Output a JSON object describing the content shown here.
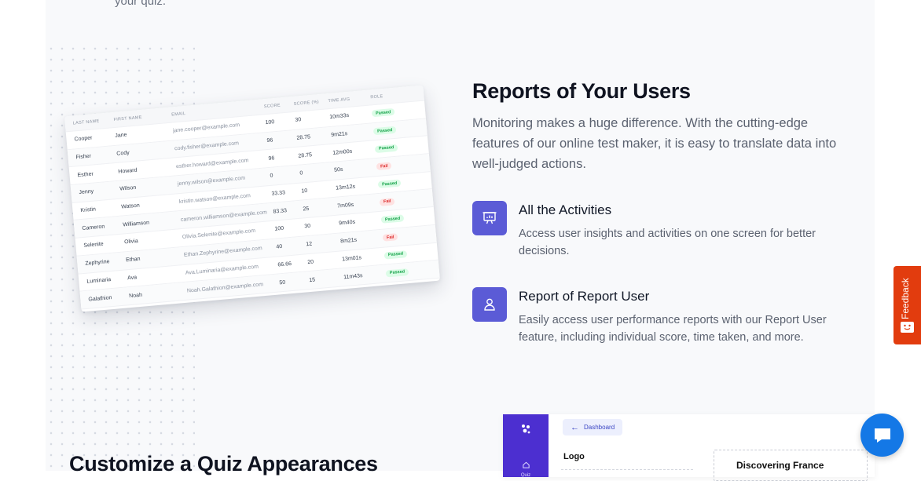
{
  "top_snippet": "your quiz.",
  "section": {
    "title": "Reports of Your Users",
    "lead": "Monitoring makes a huge difference. With the cutting-edge features of our online test maker, it is easy to translate data into well-judged actions.",
    "features": [
      {
        "title": "All the Activities",
        "desc": "Access user insights and activities on one screen for better decisions.",
        "icon": "presentation-chart-icon"
      },
      {
        "title": "Report of Report User",
        "desc": "Easily access user performance reports with our Report User feature, including individual score, time taken, and more.",
        "icon": "user-icon"
      }
    ]
  },
  "report_table": {
    "headers": [
      "Last Name",
      "First Name",
      "Email",
      "Score",
      "Score (%)",
      "Time Avg",
      "Role"
    ],
    "rows": [
      [
        "Cooper",
        "Jane",
        "jane.cooper@example.com",
        "100",
        "30",
        "10m33s",
        "Passed"
      ],
      [
        "Fisher",
        "Cody",
        "cody.fisher@example.com",
        "96",
        "28.75",
        "9m21s",
        "Passed"
      ],
      [
        "Esther",
        "Howard",
        "esther.howard@example.com",
        "96",
        "28.75",
        "12m00s",
        "Passed"
      ],
      [
        "Jenny",
        "Wilson",
        "jenny.wilson@example.com",
        "0",
        "0",
        "50s",
        "Fail"
      ],
      [
        "Kristin",
        "Watson",
        "kristin.watson@example.com",
        "33.33",
        "10",
        "13m12s",
        "Passed"
      ],
      [
        "Cameron",
        "Williamson",
        "cameron.williamson@example.com",
        "83.33",
        "25",
        "7m09s",
        "Fail"
      ],
      [
        "Selenite",
        "Olivia",
        "Olivia.Selenite@example.com",
        "100",
        "30",
        "9m40s",
        "Passed"
      ],
      [
        "Zephyrine",
        "Ethan",
        "Ethan.Zephyrine@example.com",
        "40",
        "12",
        "8m21s",
        "Fail"
      ],
      [
        "Luminaria",
        "Ava",
        "Ava.Luminaria@example.com",
        "66.66",
        "20",
        "13m01s",
        "Passed"
      ],
      [
        "Galathion",
        "Noah",
        "Noah.Galathion@example.com",
        "50",
        "15",
        "11m43s",
        "Passed"
      ]
    ]
  },
  "feedback_tab": {
    "label": "Feedback"
  },
  "bottom": {
    "title": "Customize a Quiz Appearances",
    "preview": {
      "back_label": "Dashboard",
      "nav_label": "Quiz",
      "logo_label": "Logo",
      "quiz_title": "Discovering France"
    }
  },
  "colors": {
    "accent": "#5b5bd6",
    "feedback": "#e23c0e",
    "chat": "#1478e6",
    "sidebar": "#4c2fd0"
  }
}
